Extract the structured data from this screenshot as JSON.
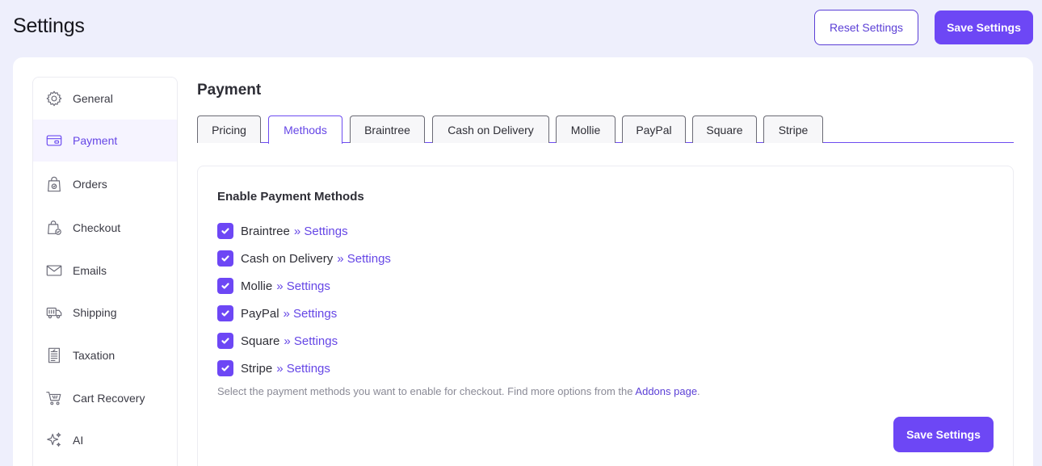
{
  "header": {
    "title": "Settings",
    "reset_label": "Reset Settings",
    "save_label": "Save Settings"
  },
  "sidebar": {
    "items": [
      {
        "label": "General",
        "icon": "gear-icon"
      },
      {
        "label": "Payment",
        "icon": "credit-card-icon",
        "active": true
      },
      {
        "label": "Orders",
        "icon": "shopping-bag-icon"
      },
      {
        "label": "Checkout",
        "icon": "bag-check-icon"
      },
      {
        "label": "Emails",
        "icon": "envelope-icon"
      },
      {
        "label": "Shipping",
        "icon": "truck-icon"
      },
      {
        "label": "Taxation",
        "icon": "receipt-icon"
      },
      {
        "label": "Cart Recovery",
        "icon": "cart-icon"
      },
      {
        "label": "AI",
        "icon": "sparkle-icon"
      }
    ]
  },
  "main": {
    "section_title": "Payment",
    "tabs": [
      {
        "label": "Pricing"
      },
      {
        "label": "Methods",
        "active": true
      },
      {
        "label": "Braintree"
      },
      {
        "label": "Cash on Delivery"
      },
      {
        "label": "Mollie"
      },
      {
        "label": "PayPal"
      },
      {
        "label": "Square"
      },
      {
        "label": "Stripe"
      }
    ],
    "panel": {
      "title": "Enable Payment Methods",
      "settings_link": "» Settings",
      "methods": [
        {
          "label": "Braintree",
          "checked": true
        },
        {
          "label": "Cash on Delivery",
          "checked": true
        },
        {
          "label": "Mollie",
          "checked": true
        },
        {
          "label": "PayPal",
          "checked": true
        },
        {
          "label": "Square",
          "checked": true
        },
        {
          "label": "Stripe",
          "checked": true
        }
      ],
      "help_text": "Select the payment methods you want to enable for checkout. Find more options from the",
      "help_link": "Addons page",
      "help_suffix": ".",
      "save_label": "Save Settings"
    }
  },
  "colors": {
    "accent": "#6d47f5",
    "link": "#6546e6",
    "background": "#eeeffc"
  }
}
